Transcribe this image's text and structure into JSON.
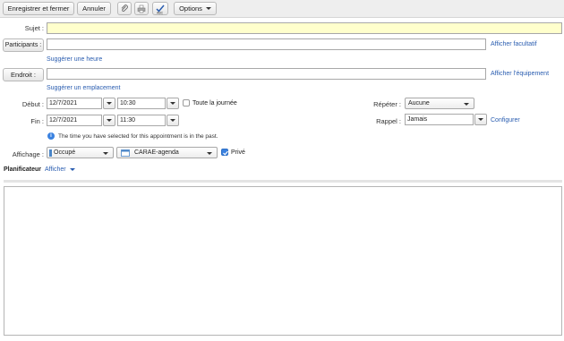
{
  "toolbar": {
    "save_close": "Enregistrer et fermer",
    "cancel": "Annuler",
    "options": "Options"
  },
  "form": {
    "subject_label": "Sujet :",
    "subject_value": "",
    "participants_button": "Participants :",
    "show_optional": "Afficher facultatif",
    "suggest_time": "Suggérer une heure",
    "location_button": "Endroit :",
    "show_equipment": "Afficher l'équipement",
    "suggest_location": "Suggérer un emplacement",
    "start_label": "Début :",
    "start_date": "12/7/2021",
    "start_time": "10:30",
    "all_day": "Toute la journée",
    "repeat_label": "Répéter :",
    "repeat_value": "Aucune",
    "end_label": "Fin :",
    "end_date": "12/7/2021",
    "end_time": "11:30",
    "reminder_label": "Rappel :",
    "reminder_value": "Jamais",
    "configure": "Configurer",
    "past_notice": "The time you have selected for this appointment is in the past.",
    "display_label": "Affichage :",
    "display_value": "Occupé",
    "calendar_value": "CARAE-agenda",
    "private_label": "Privé"
  },
  "scheduler": {
    "title": "Planificateur",
    "show": "Afficher"
  },
  "colors": {
    "accent_link": "#2a5db0",
    "subject_bg": "#ffffcc",
    "busy_bar": "#4a86c8",
    "checkbox_checked": "#3b82e0"
  }
}
